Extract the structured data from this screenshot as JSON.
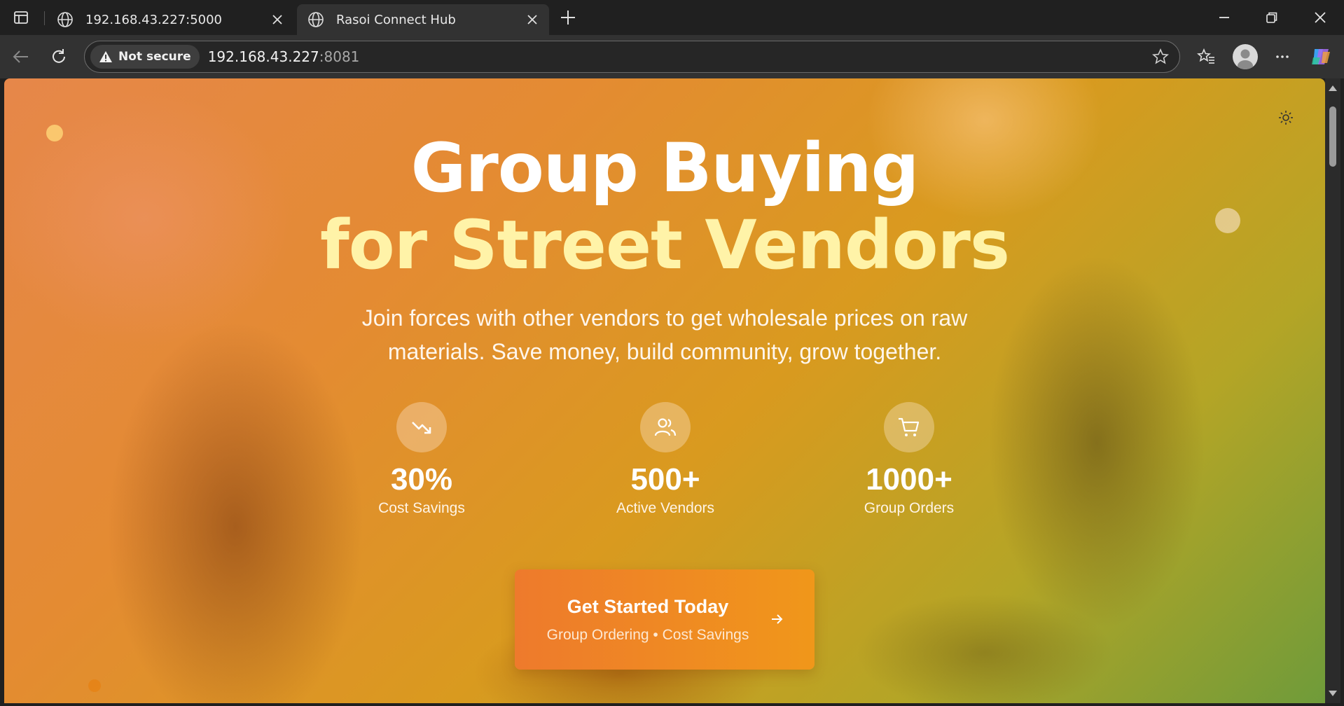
{
  "browser": {
    "tabs": [
      {
        "label": "192.168.43.227:5000",
        "active": false
      },
      {
        "label": "Rasoi Connect Hub",
        "active": true
      }
    ],
    "address": {
      "security_label": "Not secure",
      "host": "192.168.43.227",
      "port": ":8081"
    }
  },
  "hero": {
    "title_line1": "Group Buying",
    "title_line2": "for Street Vendors",
    "subtitle": "Join forces with other vendors to get wholesale prices on raw materials. Save money, build community, grow together.",
    "stats": [
      {
        "icon": "trending-down-icon",
        "value": "30%",
        "label": "Cost Savings"
      },
      {
        "icon": "users-icon",
        "value": "500+",
        "label": "Active Vendors"
      },
      {
        "icon": "shopping-cart-icon",
        "value": "1000+",
        "label": "Group Orders"
      }
    ],
    "cta": {
      "title": "Get Started Today",
      "subtitle": "Group Ordering • Cost Savings",
      "icon": "arrow-right-icon"
    }
  },
  "colors": {
    "title_primary": "#ffffff",
    "title_accent": "#fff3a8",
    "cta_start": "#ee7a2c",
    "cta_end": "#f0971a"
  }
}
